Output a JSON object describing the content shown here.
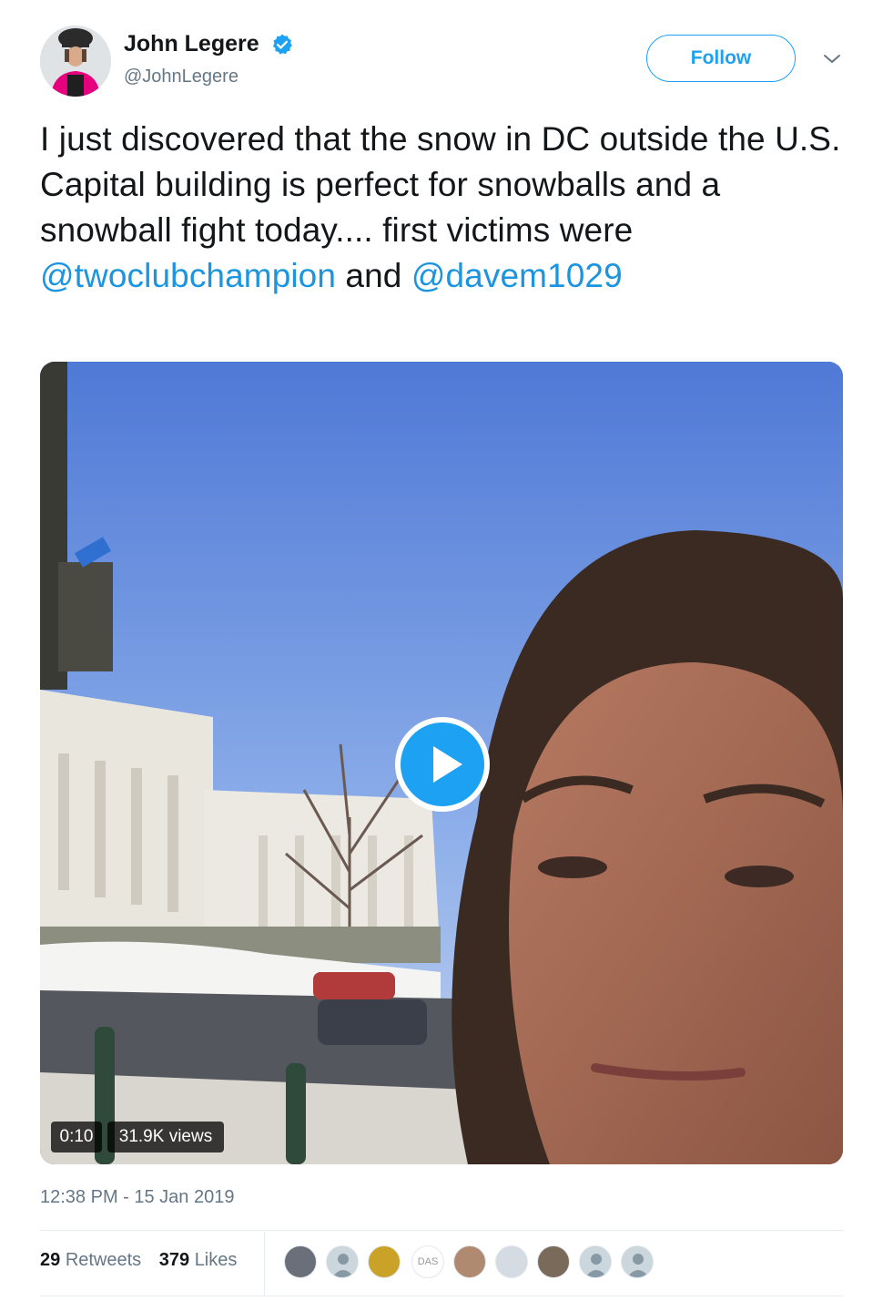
{
  "user": {
    "display_name": "John Legere",
    "handle": "@JohnLegere",
    "verified": true,
    "avatar_icon": "user-avatar"
  },
  "actions": {
    "follow_label": "Follow",
    "menu_icon": "chevron-down-icon"
  },
  "tweet": {
    "text_part1": "I just discovered that the snow in DC outside the U.S. Capital building is perfect for snowballs and a snowball fight today.... first victims were ",
    "mention1": "@twoclubchampion",
    "text_part2": " and ",
    "mention2": "@davem1029"
  },
  "media": {
    "type": "video",
    "duration": "0:10",
    "views": "31.9K views",
    "play_icon": "play-icon"
  },
  "meta": {
    "timestamp": "12:38 PM - 15 Jan 2019"
  },
  "stats": {
    "retweets_count": "29",
    "retweets_label": "Retweets",
    "likes_count": "379",
    "likes_label": "Likes"
  },
  "likers": {
    "labeled_avatar_text": "DAS"
  },
  "colors": {
    "accent": "#1da1f2",
    "mention": "#1b95e0",
    "text": "#14171a",
    "muted": "#657786",
    "verified": "#1da1f2"
  }
}
